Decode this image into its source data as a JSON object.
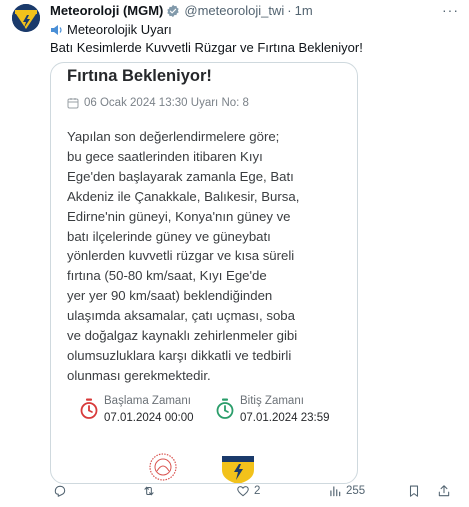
{
  "tweet": {
    "author_name": "Meteoroloji (MGM)",
    "handle": "@meteoroloji_twi",
    "separator": "·",
    "time": "1m",
    "more_glyph": "···",
    "line1": "Meteorolojik Uyarı",
    "line2": "Batı Kesimlerde Kuvvetli Rüzgar ve Fırtına Bekleniyor!",
    "verified_color": "#829aab"
  },
  "card": {
    "title": "Fırtına Bekleniyor!",
    "date_line": "06 Ocak 2024 13:30 Uyarı No: 8",
    "body_lines": [
      "Yapılan son değerlendirmelere göre;",
      "bu gece saatlerinden itibaren Kıyı",
      "Ege'den başlayarak zamanla Ege, Batı",
      "Akdeniz ile Çanakkale, Balıkesir, Bursa,",
      "Edirne'nin güneyi, Konya'nın güney ve",
      "batı ilçelerinde güney ve güneybatı",
      "yönlerden kuvvetli rüzgar ve kısa süreli",
      "fırtına (50-80 km/saat, Kıyı Ege'de",
      "yer yer 90 km/saat) beklendiğinden",
      "ulaşımda aksamalar, çatı uçması, soba",
      "ve doğalgaz kaynaklı zehirlenmeler gibi",
      "olumsuzluklara karşı dikkatli ve tedbirli",
      "olunması gerekmektedir."
    ],
    "start": {
      "label": "Başlama Zamanı",
      "value": "07.01.2024 00:00",
      "icon": "red-timer-icon",
      "color": "#d83a3a"
    },
    "end": {
      "label": "Bitiş Zamanı",
      "value": "07.01.2024 23:59",
      "icon": "green-timer-icon",
      "color": "#2a9d6a"
    }
  },
  "actions": {
    "reply_count": "",
    "retweet_count": "",
    "like_count": "2",
    "views_count": "255"
  }
}
